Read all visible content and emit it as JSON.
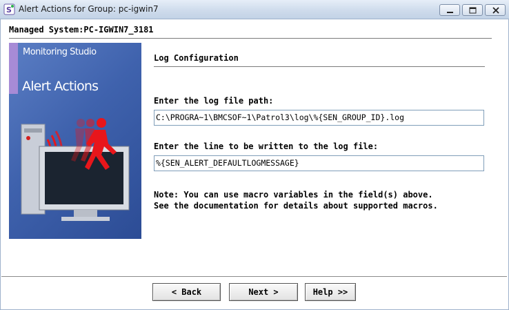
{
  "window": {
    "title": "Alert Actions for Group: pc-igwin7"
  },
  "header": {
    "managed_system": "Managed System:PC-IGWIN7_3181"
  },
  "banner": {
    "line1": "Monitoring Studio",
    "line2": "Alert Actions"
  },
  "section": {
    "title": "Log Configuration"
  },
  "form": {
    "log_path_label": "Enter the log file path:",
    "log_path_value": "C:\\PROGRA~1\\BMCSOF~1\\Patrol3\\log\\%{SEN_GROUP_ID}.log",
    "log_line_label": "Enter the line to be written to the log file:",
    "log_line_value": "%{SEN_ALERT_DEFAULTLOGMESSAGE}"
  },
  "note": {
    "line1": "Note: You can use macro variables in the field(s) above.",
    "line2": "See the documentation for details about supported macros."
  },
  "buttons": {
    "back": "< Back",
    "next": "Next >",
    "help": "Help >>"
  },
  "colors": {
    "banner_blue": "#3f62ad",
    "banner_strip": "#a78bd6",
    "figure_red": "#e8161b"
  }
}
